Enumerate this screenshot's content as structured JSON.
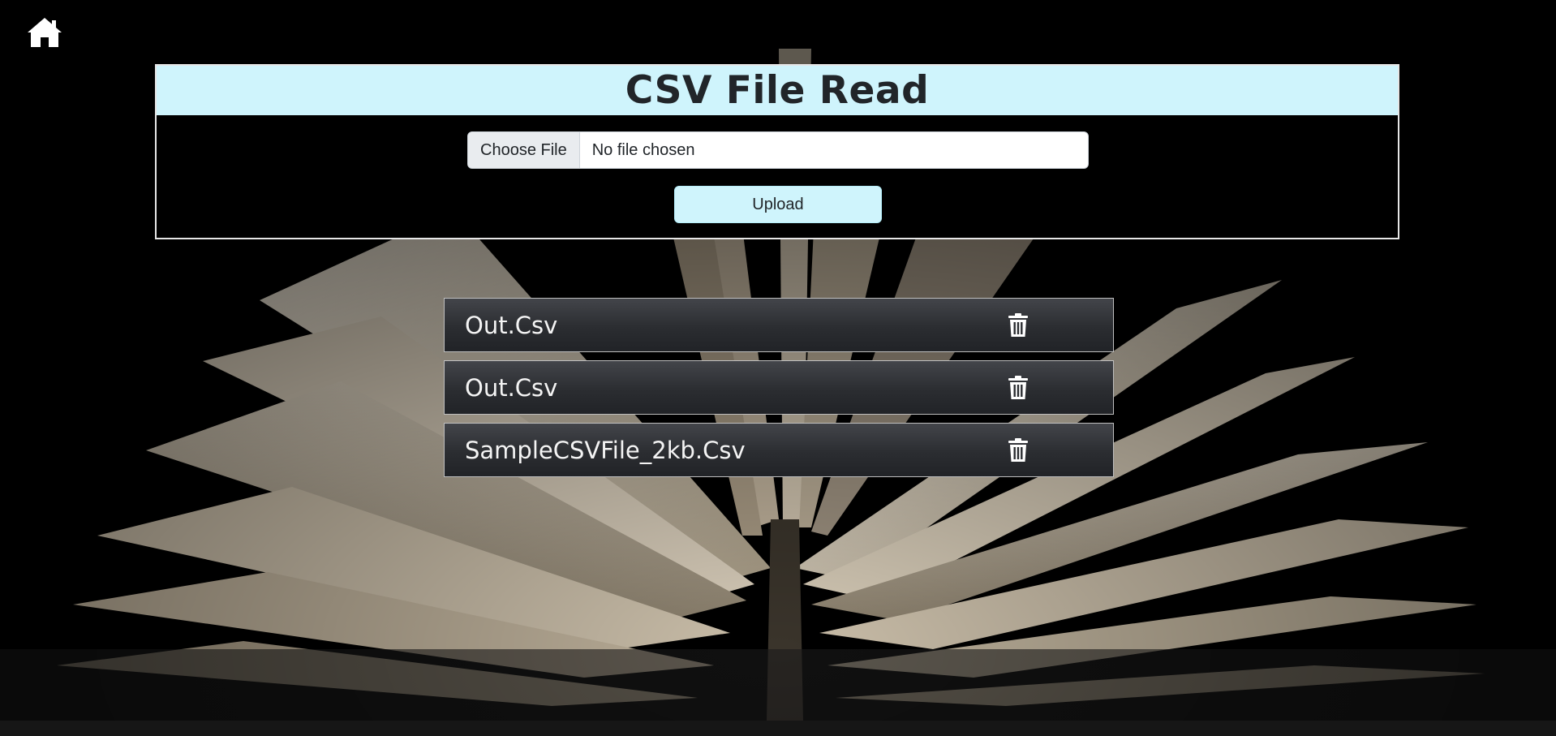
{
  "nav": {
    "home_icon": "house-icon"
  },
  "upload": {
    "title": "CSV File Read",
    "choose_file_label": "Choose File",
    "file_status": "No file chosen",
    "upload_label": "Upload"
  },
  "files": [
    {
      "name": "Out.Csv",
      "delete_icon": "trash-icon"
    },
    {
      "name": "Out.Csv",
      "delete_icon": "trash-icon"
    },
    {
      "name": "SampleCSVFile_2kb.Csv",
      "delete_icon": "trash-icon"
    }
  ],
  "colors": {
    "header_bg": "#cff4fc",
    "upload_button_bg": "#cff4fc",
    "list_row_bg": "#2b2d31",
    "page_bg": "#000000"
  }
}
